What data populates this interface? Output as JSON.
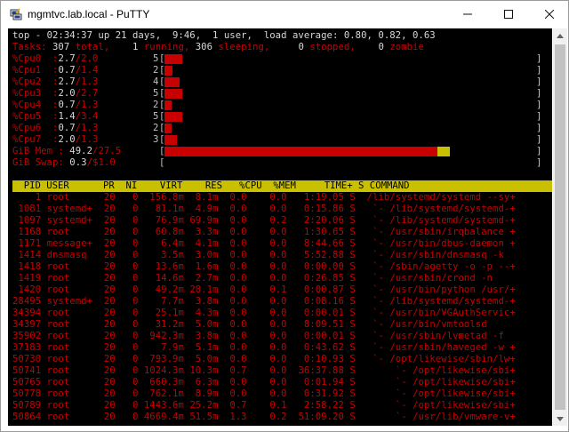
{
  "window": {
    "title": "mgmtvc.lab.local - PuTTY"
  },
  "colors": {
    "red": "#c80000",
    "yellow": "#c8c000",
    "grey": "#c0c0c0"
  },
  "summary": {
    "line1": "top - 02:34:37 up 21 days,  9:46,  1 user,  load average: 0.80, 0.82, 0.63",
    "tasks_label": "Tasks:",
    "tasks_total": " 307 ",
    "tasks_total_label": "total,",
    "tasks_running": "    1 ",
    "tasks_running_label": "running,",
    "tasks_sleeping": " 306 ",
    "tasks_sleeping_label": "sleeping,",
    "tasks_stopped": "     0 ",
    "tasks_stopped_label": "stopped,",
    "tasks_zombie": "    0 ",
    "tasks_zombie_label": "zombie"
  },
  "cpus": [
    {
      "label": "%Cpu0  :",
      "us": "2.7",
      "sy": "2.0",
      "n": "5",
      "level": 0.047
    },
    {
      "label": "%Cpu1  :",
      "us": "0.7",
      "sy": "1.4",
      "n": "2",
      "level": 0.021
    },
    {
      "label": "%Cpu2  :",
      "us": "2.7",
      "sy": "1.3",
      "n": "4",
      "level": 0.04
    },
    {
      "label": "%Cpu3  :",
      "us": "2.0",
      "sy": "2.7",
      "n": "5",
      "level": 0.047
    },
    {
      "label": "%Cpu4  :",
      "us": "0.7",
      "sy": "1.3",
      "n": "2",
      "level": 0.02
    },
    {
      "label": "%Cpu5  :",
      "us": "1.4",
      "sy": "3.4",
      "n": "5",
      "level": 0.048
    },
    {
      "label": "%Cpu6  :",
      "us": "0.7",
      "sy": "1.3",
      "n": "2",
      "level": 0.02
    },
    {
      "label": "%Cpu7  :",
      "us": "2.0",
      "sy": "1.3",
      "n": "3",
      "level": 0.033
    }
  ],
  "mem": {
    "label": "GiB Mem :",
    "used": "49.2",
    "total": "27.5",
    "level": 0.768
  },
  "swap": {
    "label": "GiB Swap:",
    "used": "0.3",
    "total": "$1.0"
  },
  "header": "  PID USER      PR  NI    VIRT    RES   %CPU  %MEM     TIME+ S COMMAND",
  "processes": [
    {
      "pid": "    1",
      "user": "root     ",
      "pr": "20",
      "ni": " 0",
      "virt": "  156.8m",
      "res": "  8.1m",
      "cpu": "  0.0",
      "mem": "  0.0",
      "time": "  1:19.05",
      "s": "S",
      "cmd": " /lib/systemd/systemd --sy+"
    },
    {
      "pid": " 1081",
      "user": "systemd+ ",
      "pr": "20",
      "ni": " 0",
      "virt": "   81.1m",
      "res": "  4.9m",
      "cpu": "  0.0",
      "mem": "  0.0",
      "time": "  0:15.86",
      "s": "S",
      "cmd": "  `- /lib/systemd/systemd-+"
    },
    {
      "pid": " 1097",
      "user": "systemd+ ",
      "pr": "20",
      "ni": " 0",
      "virt": "   76.9m",
      "res": " 69.9m",
      "cpu": "  0.0",
      "mem": "  0.2",
      "time": "  2:20.06",
      "s": "S",
      "cmd": "  `- /lib/systemd/systemd-+"
    },
    {
      "pid": " 1168",
      "user": "root     ",
      "pr": "20",
      "ni": " 0",
      "virt": "   60.8m",
      "res": "  3.3m",
      "cpu": "  0.0",
      "mem": "  0.0",
      "time": "  1:30.65",
      "s": "S",
      "cmd": "  `- /usr/sbin/irqbalance +"
    },
    {
      "pid": " 1171",
      "user": "message+ ",
      "pr": "20",
      "ni": " 0",
      "virt": "    6.4m",
      "res": "  4.1m",
      "cpu": "  0.0",
      "mem": "  0.0",
      "time": "  8:44.66",
      "s": "S",
      "cmd": "  `- /usr/bin/dbus-daemon +"
    },
    {
      "pid": " 1414",
      "user": "dnsmasq  ",
      "pr": "20",
      "ni": " 0",
      "virt": "    3.5m",
      "res": "  3.0m",
      "cpu": "  0.0",
      "mem": "  0.0",
      "time": "  5:52.88",
      "s": "S",
      "cmd": "  `- /usr/sbin/dnsmasq -k"
    },
    {
      "pid": " 1418",
      "user": "root     ",
      "pr": "20",
      "ni": " 0",
      "virt": "   13.6m",
      "res": "  1.6m",
      "cpu": "  0.0",
      "mem": "  0.0",
      "time": "  0:00.00",
      "s": "S",
      "cmd": "  `- /sbin/agetty -o -p --+"
    },
    {
      "pid": " 1419",
      "user": "root     ",
      "pr": "20",
      "ni": " 0",
      "virt": "   14.6m",
      "res": "  2.7m",
      "cpu": "  0.0",
      "mem": "  0.0",
      "time": "  0:26.85",
      "s": "S",
      "cmd": "  `- /usr/sbin/crond -n"
    },
    {
      "pid": " 1420",
      "user": "root     ",
      "pr": "20",
      "ni": " 0",
      "virt": "   49.2m",
      "res": " 28.1m",
      "cpu": "  0.0",
      "mem": "  0.1",
      "time": "  0:00.87",
      "s": "S",
      "cmd": "  `- /usr/bin/python /usr/+"
    },
    {
      "pid": "28495",
      "user": "systemd+ ",
      "pr": "20",
      "ni": " 0",
      "virt": "    7.7m",
      "res": "  3.8m",
      "cpu": "  0.0",
      "mem": "  0.0",
      "time": "  0:08.16",
      "s": "S",
      "cmd": "  `- /lib/systemd/systemd-+"
    },
    {
      "pid": "34394",
      "user": "root     ",
      "pr": "20",
      "ni": " 0",
      "virt": "   25.1m",
      "res": "  4.3m",
      "cpu": "  0.0",
      "mem": "  0.0",
      "time": "  0:00.01",
      "s": "S",
      "cmd": "  `- /usr/bin/VGAuthServic+"
    },
    {
      "pid": "34397",
      "user": "root     ",
      "pr": "20",
      "ni": " 0",
      "virt": "   31.2m",
      "res": "  5.0m",
      "cpu": "  0.0",
      "mem": "  0.0",
      "time": "  8:09.51",
      "s": "S",
      "cmd": "  `- /usr/bin/vmtoolsd"
    },
    {
      "pid": "35902",
      "user": "root     ",
      "pr": "20",
      "ni": " 0",
      "virt": "  942.3m",
      "res": "  3.8m",
      "cpu": "  0.0",
      "mem": "  0.0",
      "time": "  0:00.01",
      "s": "S",
      "cmd": "  `- /usr/sbin/lvmetad -f"
    },
    {
      "pid": "37183",
      "user": "root     ",
      "pr": "20",
      "ni": " 0",
      "virt": "    7.9m",
      "res": "  5.1m",
      "cpu": "  0.0",
      "mem": "  0.0",
      "time": "  0:43.62",
      "s": "S",
      "cmd": "  `- /usr/sbin/haveged -w +"
    },
    {
      "pid": "50730",
      "user": "root     ",
      "pr": "20",
      "ni": " 0",
      "virt": "  793.9m",
      "res": "  5.0m",
      "cpu": "  0.0",
      "mem": "  0.0",
      "time": "  0:10.93",
      "s": "S",
      "cmd": "  `- /opt/likewise/sbin/lw+"
    },
    {
      "pid": "50741",
      "user": "root     ",
      "pr": "20",
      "ni": " 0",
      "virt": " 1024.3m",
      "res": " 10.3m",
      "cpu": "  0.7",
      "mem": "  0.0",
      "time": " 36:37.88",
      "s": "S",
      "cmd": "      `- /opt/likewise/sbi+"
    },
    {
      "pid": "50765",
      "user": "root     ",
      "pr": "20",
      "ni": " 0",
      "virt": "  660.3m",
      "res": "  6.3m",
      "cpu": "  0.0",
      "mem": "  0.0",
      "time": "  0:01.94",
      "s": "S",
      "cmd": "      `- /opt/likewise/sbi+"
    },
    {
      "pid": "50778",
      "user": "root     ",
      "pr": "20",
      "ni": " 0",
      "virt": "  762.1m",
      "res": "  8.9m",
      "cpu": "  0.0",
      "mem": "  0.0",
      "time": "  0:31.92",
      "s": "S",
      "cmd": "      `- /opt/likewise/sbi+"
    },
    {
      "pid": "50789",
      "user": "root     ",
      "pr": "20",
      "ni": " 0",
      "virt": " 1443.6m",
      "res": " 25.2m",
      "cpu": "  0.7",
      "mem": "  0.1",
      "time": "  2:58.22",
      "s": "S",
      "cmd": "      `- /opt/likewise/sbi+"
    },
    {
      "pid": "50864",
      "user": "root     ",
      "pr": "20",
      "ni": " 0",
      "virt": " 4669.4m",
      "res": " 51.5m",
      "cpu": "  1.3",
      "mem": "  0.2",
      "time": " 51:09.20",
      "s": "S",
      "cmd": "      `- /usr/lib/vmware-v+"
    }
  ]
}
